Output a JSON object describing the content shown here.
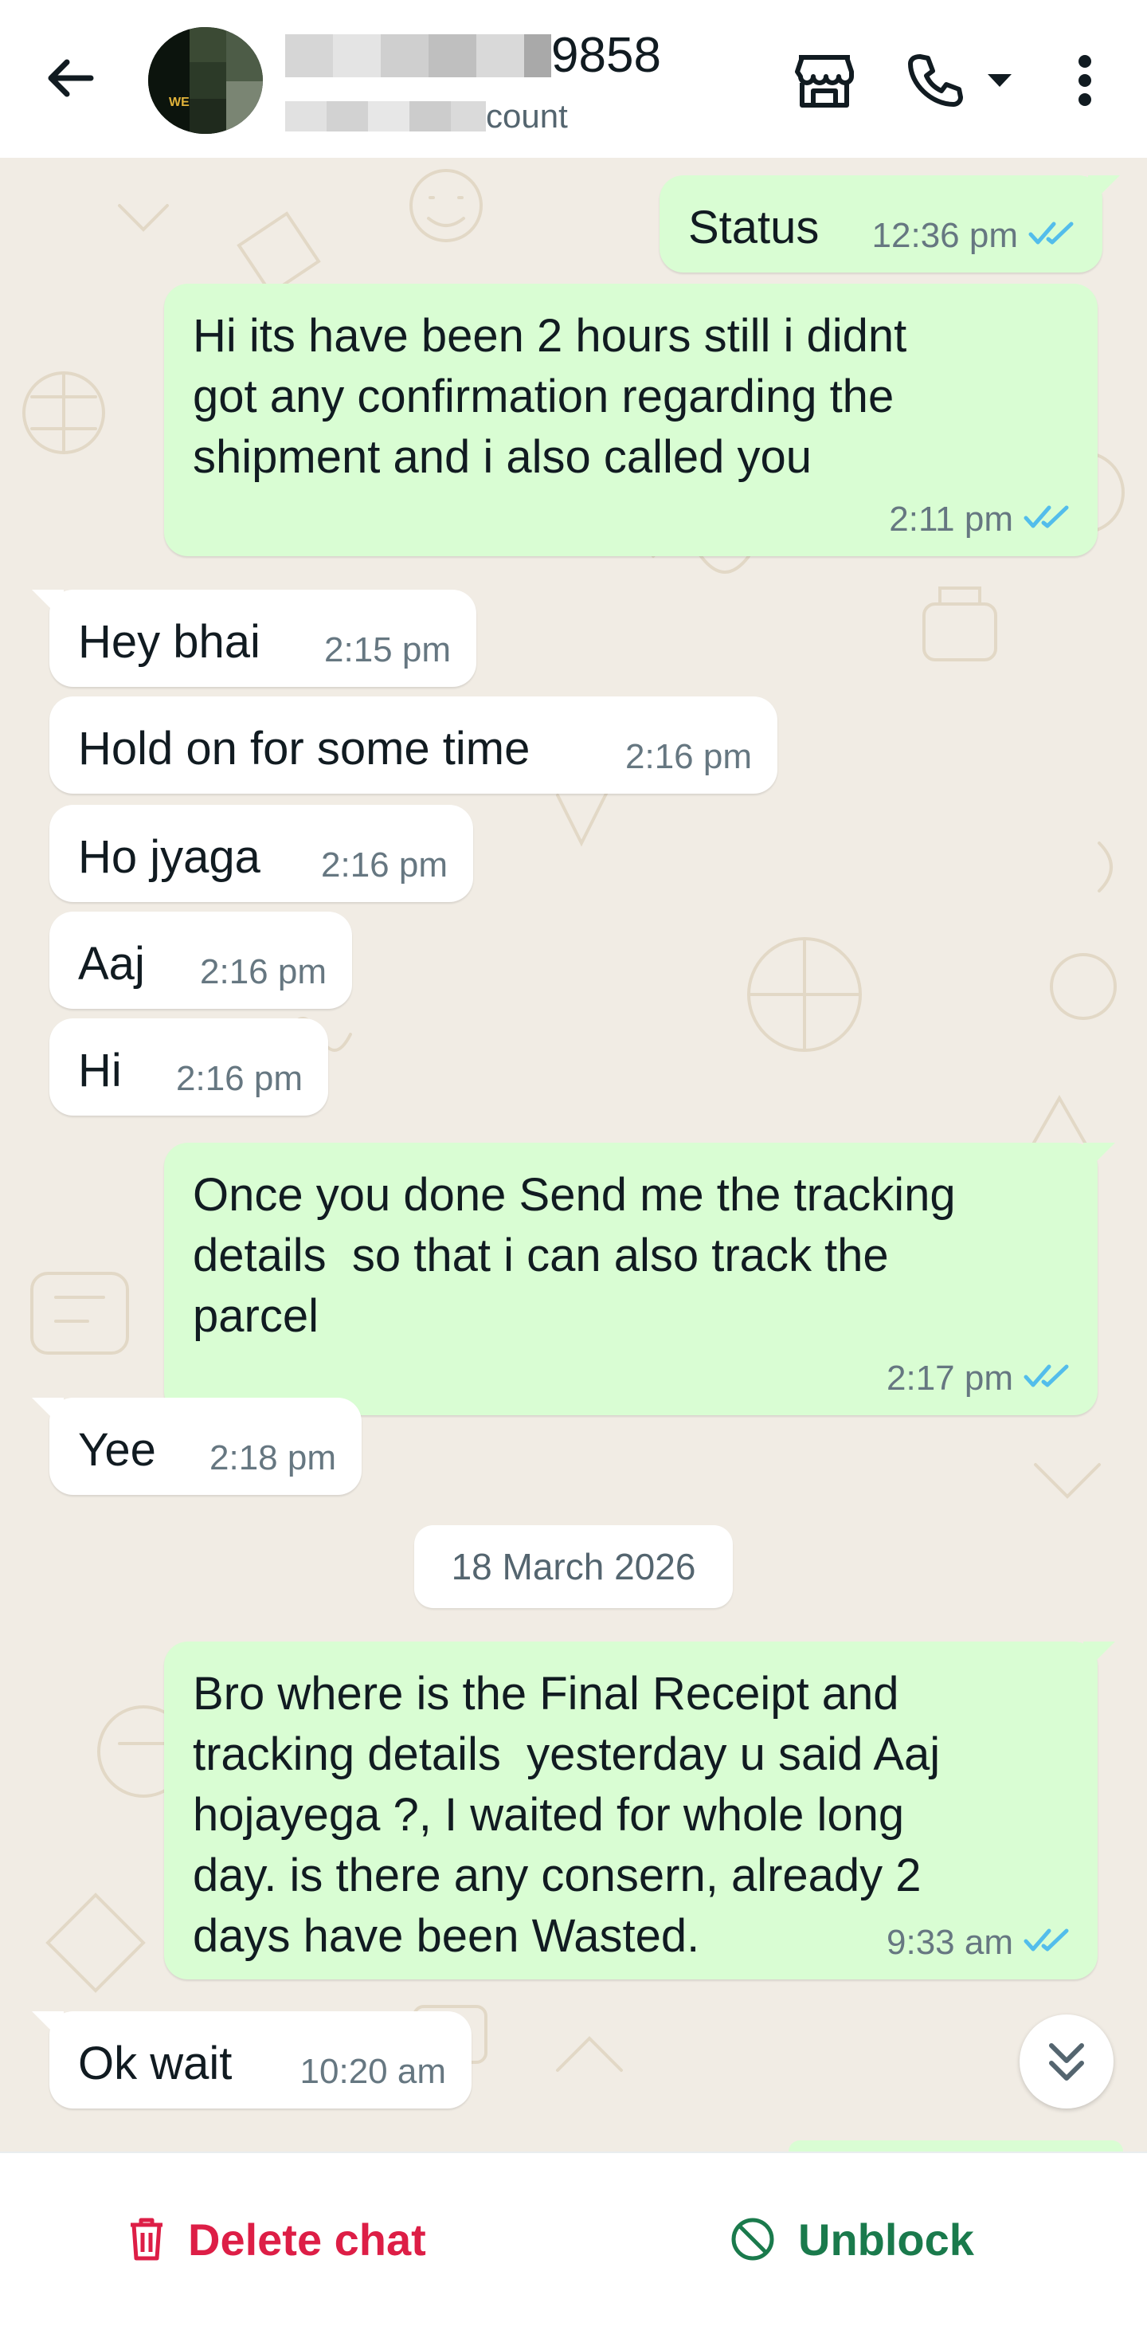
{
  "header": {
    "contact_name_suffix": "9858",
    "contact_subtitle_suffix": "count",
    "icons": [
      "back-arrow-icon",
      "store-icon",
      "phone-icon",
      "dropdown-icon",
      "more-vert-icon"
    ]
  },
  "messages": [
    {
      "dir": "out",
      "text": "Status",
      "time": "12:36 pm",
      "ticks": "read"
    },
    {
      "dir": "out",
      "text": "Hi its have been 2 hours still i didnt\ngot any confirmation regarding the\nshipment and i also called you",
      "time": "2:11 pm",
      "ticks": "read"
    },
    {
      "dir": "in",
      "text": "Hey bhai",
      "time": "2:15 pm"
    },
    {
      "dir": "in",
      "text": "Hold on for some time",
      "time": "2:16 pm"
    },
    {
      "dir": "in",
      "text": "Ho jyaga",
      "time": "2:16 pm"
    },
    {
      "dir": "in",
      "text": "Aaj",
      "time": "2:16 pm"
    },
    {
      "dir": "in",
      "text": "Hi",
      "time": "2:16 pm"
    },
    {
      "dir": "out",
      "text": "Once you done Send me the tracking\ndetails  so that i can also track the\nparcel",
      "time": "2:17 pm",
      "ticks": "read"
    },
    {
      "dir": "in",
      "text": "Yee",
      "time": "2:18 pm"
    },
    {
      "dir": "out",
      "text": "Bro where is the Final Receipt and\ntracking details  yesterday u said Aaj\nhojayega ?, I waited for whole long\nday. is there any consern, already 2\ndays have been Wasted.",
      "time": "9:33 am",
      "ticks": "read"
    },
    {
      "dir": "in",
      "text": "Ok wait",
      "time": "10:20 am"
    }
  ],
  "date_separator": "18 March 2026",
  "bottom_bar": {
    "delete_label": "Delete chat",
    "unblock_label": "Unblock"
  },
  "colors": {
    "outgoing_bubble": "#d9fdd3",
    "incoming_bubble": "#ffffff",
    "read_ticks": "#53bdeb",
    "delete": "#dd1e46",
    "unblock": "#1a7a4c"
  }
}
